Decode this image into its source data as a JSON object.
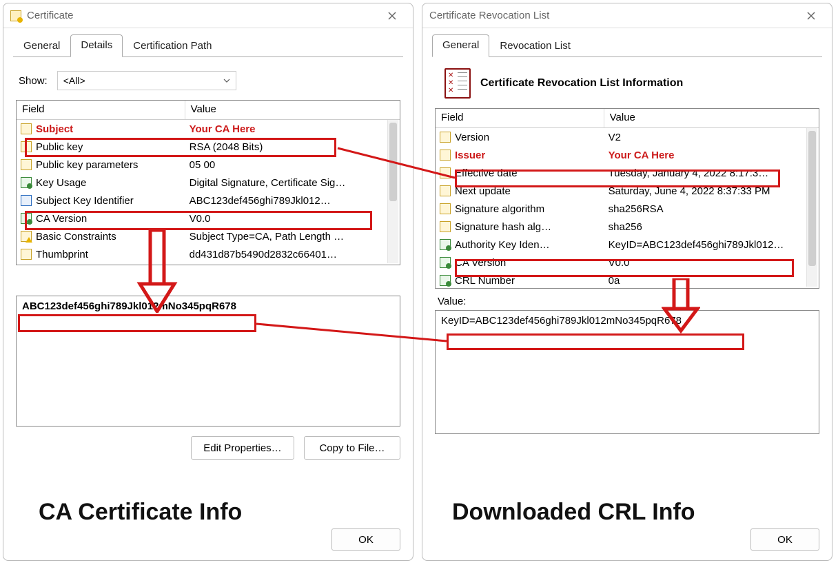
{
  "left": {
    "title": "Certificate",
    "tabs": [
      "General",
      "Details",
      "Certification Path"
    ],
    "active_tab": "Details",
    "show_label": "Show:",
    "show_value": "<All>",
    "headers": {
      "field": "Field",
      "value": "Value"
    },
    "rows": [
      {
        "icon": "ficon",
        "field": "Subject",
        "value": "Your CA Here",
        "red": true
      },
      {
        "icon": "ficon",
        "field": "Public key",
        "value": "RSA (2048 Bits)"
      },
      {
        "icon": "ficon",
        "field": "Public key parameters",
        "value": "05 00"
      },
      {
        "icon": "green",
        "field": "Key Usage",
        "value": "Digital Signature, Certificate Sig…"
      },
      {
        "icon": "blue",
        "field": "Subject Key Identifier",
        "value": "ABC123def456ghi789Jkl012…"
      },
      {
        "icon": "green",
        "field": "CA Version",
        "value": "V0.0"
      },
      {
        "icon": "warn",
        "field": "Basic Constraints",
        "value": "Subject Type=CA, Path Length …"
      },
      {
        "icon": "ficon",
        "field": "Thumbprint",
        "value": "dd431d87b5490d2832c66401…"
      }
    ],
    "detail_value": "ABC123def456ghi789Jkl012mNo345pqR678",
    "buttons": {
      "edit": "Edit Properties…",
      "copy": "Copy to File…"
    },
    "ok": "OK",
    "caption": "CA Certificate Info"
  },
  "right": {
    "title": "Certificate Revocation List",
    "tabs": [
      "General",
      "Revocation List"
    ],
    "active_tab": "General",
    "info_heading": "Certificate Revocation List Information",
    "headers": {
      "field": "Field",
      "value": "Value"
    },
    "rows": [
      {
        "icon": "ficon",
        "field": "Version",
        "value": "V2"
      },
      {
        "icon": "ficon",
        "field": "Issuer",
        "value": "Your CA Here",
        "red": true
      },
      {
        "icon": "ficon",
        "field": "Effective date",
        "value": "Tuesday, January 4, 2022 8:17:3…"
      },
      {
        "icon": "ficon",
        "field": "Next update",
        "value": "Saturday, June 4, 2022 8:37:33 PM"
      },
      {
        "icon": "ficon",
        "field": "Signature algorithm",
        "value": "sha256RSA"
      },
      {
        "icon": "ficon",
        "field": "Signature hash alg…",
        "value": "sha256"
      },
      {
        "icon": "green",
        "field": "Authority Key Iden…",
        "value": "KeyID=ABC123def456ghi789Jkl012…"
      },
      {
        "icon": "green",
        "field": "CA Version",
        "value": "V0.0"
      },
      {
        "icon": "green",
        "field": "CRL Number",
        "value": "0a"
      }
    ],
    "value_label": "Value:",
    "detail_value": "KeyID=ABC123def456ghi789Jkl012mNo345pqR678",
    "ok": "OK",
    "caption": "Downloaded CRL Info"
  }
}
